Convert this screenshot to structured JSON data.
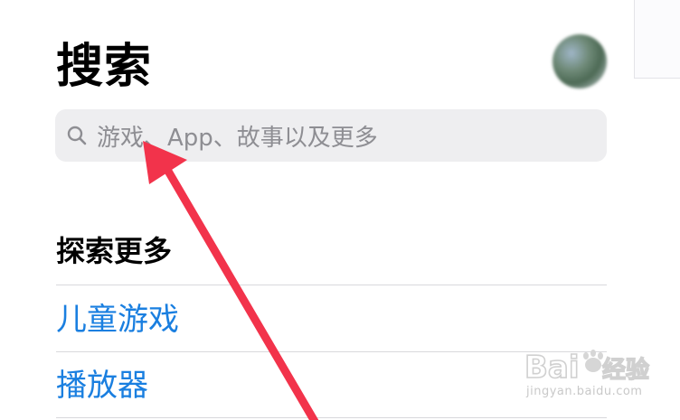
{
  "header": {
    "title": "搜索"
  },
  "search": {
    "placeholder": "游戏、App、故事以及更多"
  },
  "explore": {
    "title": "探索更多",
    "items": [
      {
        "label": "儿童游戏"
      },
      {
        "label": "播放器"
      }
    ]
  },
  "watermark": {
    "logo_text": "Baidu经验",
    "url": "jingyan.baidu.com"
  },
  "colors": {
    "link": "#1a7fe0",
    "annotation_arrow": "#f2334b",
    "search_bg": "#eeeef0"
  },
  "icons": {
    "search": "search-icon",
    "avatar": "avatar"
  }
}
